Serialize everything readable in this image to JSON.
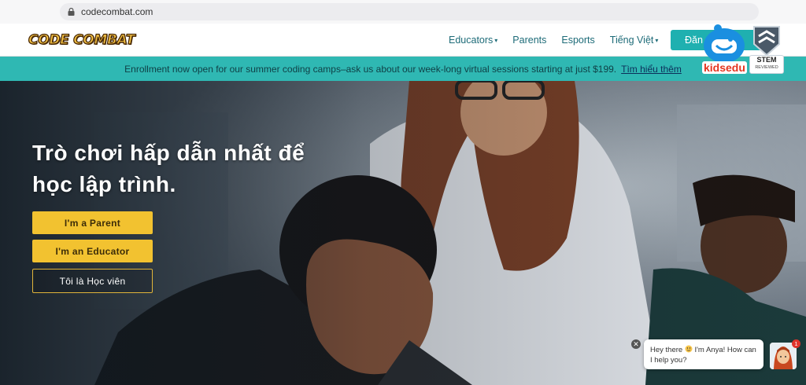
{
  "browser": {
    "url": "codecombat.com",
    "lock_icon": "lock-icon"
  },
  "header": {
    "logo_text": "CODE COMBAT",
    "nav": [
      {
        "label": "Educators",
        "has_caret": true
      },
      {
        "label": "Parents",
        "has_caret": false
      },
      {
        "label": "Esports",
        "has_caret": false
      },
      {
        "label": "Tiếng Việt",
        "has_caret": true
      }
    ],
    "login_label": "Đăn"
  },
  "banner": {
    "text": "Enrollment now open for our summer coding camps–ask us about our week-long virtual sessions starting at just $199.",
    "link": "Tìm hiểu thêm"
  },
  "hero": {
    "title_line1": "Trò chơi hấp dẫn nhất để",
    "title_line2": "học lập trình.",
    "buttons": {
      "parent": "I'm a Parent",
      "educator": "I'm an Educator",
      "student": "Tôi là Học viên"
    }
  },
  "overlay": {
    "kidsedu_text": "kidsedu",
    "stem_text": "STEM",
    "stem_sub": "REVIEWED"
  },
  "chat": {
    "message_part1": "Hey there ",
    "message_part2": "I'm Anya! How can I help you?",
    "close_symbol": "✕",
    "unread_count": "1"
  },
  "colors": {
    "accent_teal": "#2fb8b3",
    "button_yellow": "#f2c230",
    "nav_text": "#1d6b78"
  }
}
